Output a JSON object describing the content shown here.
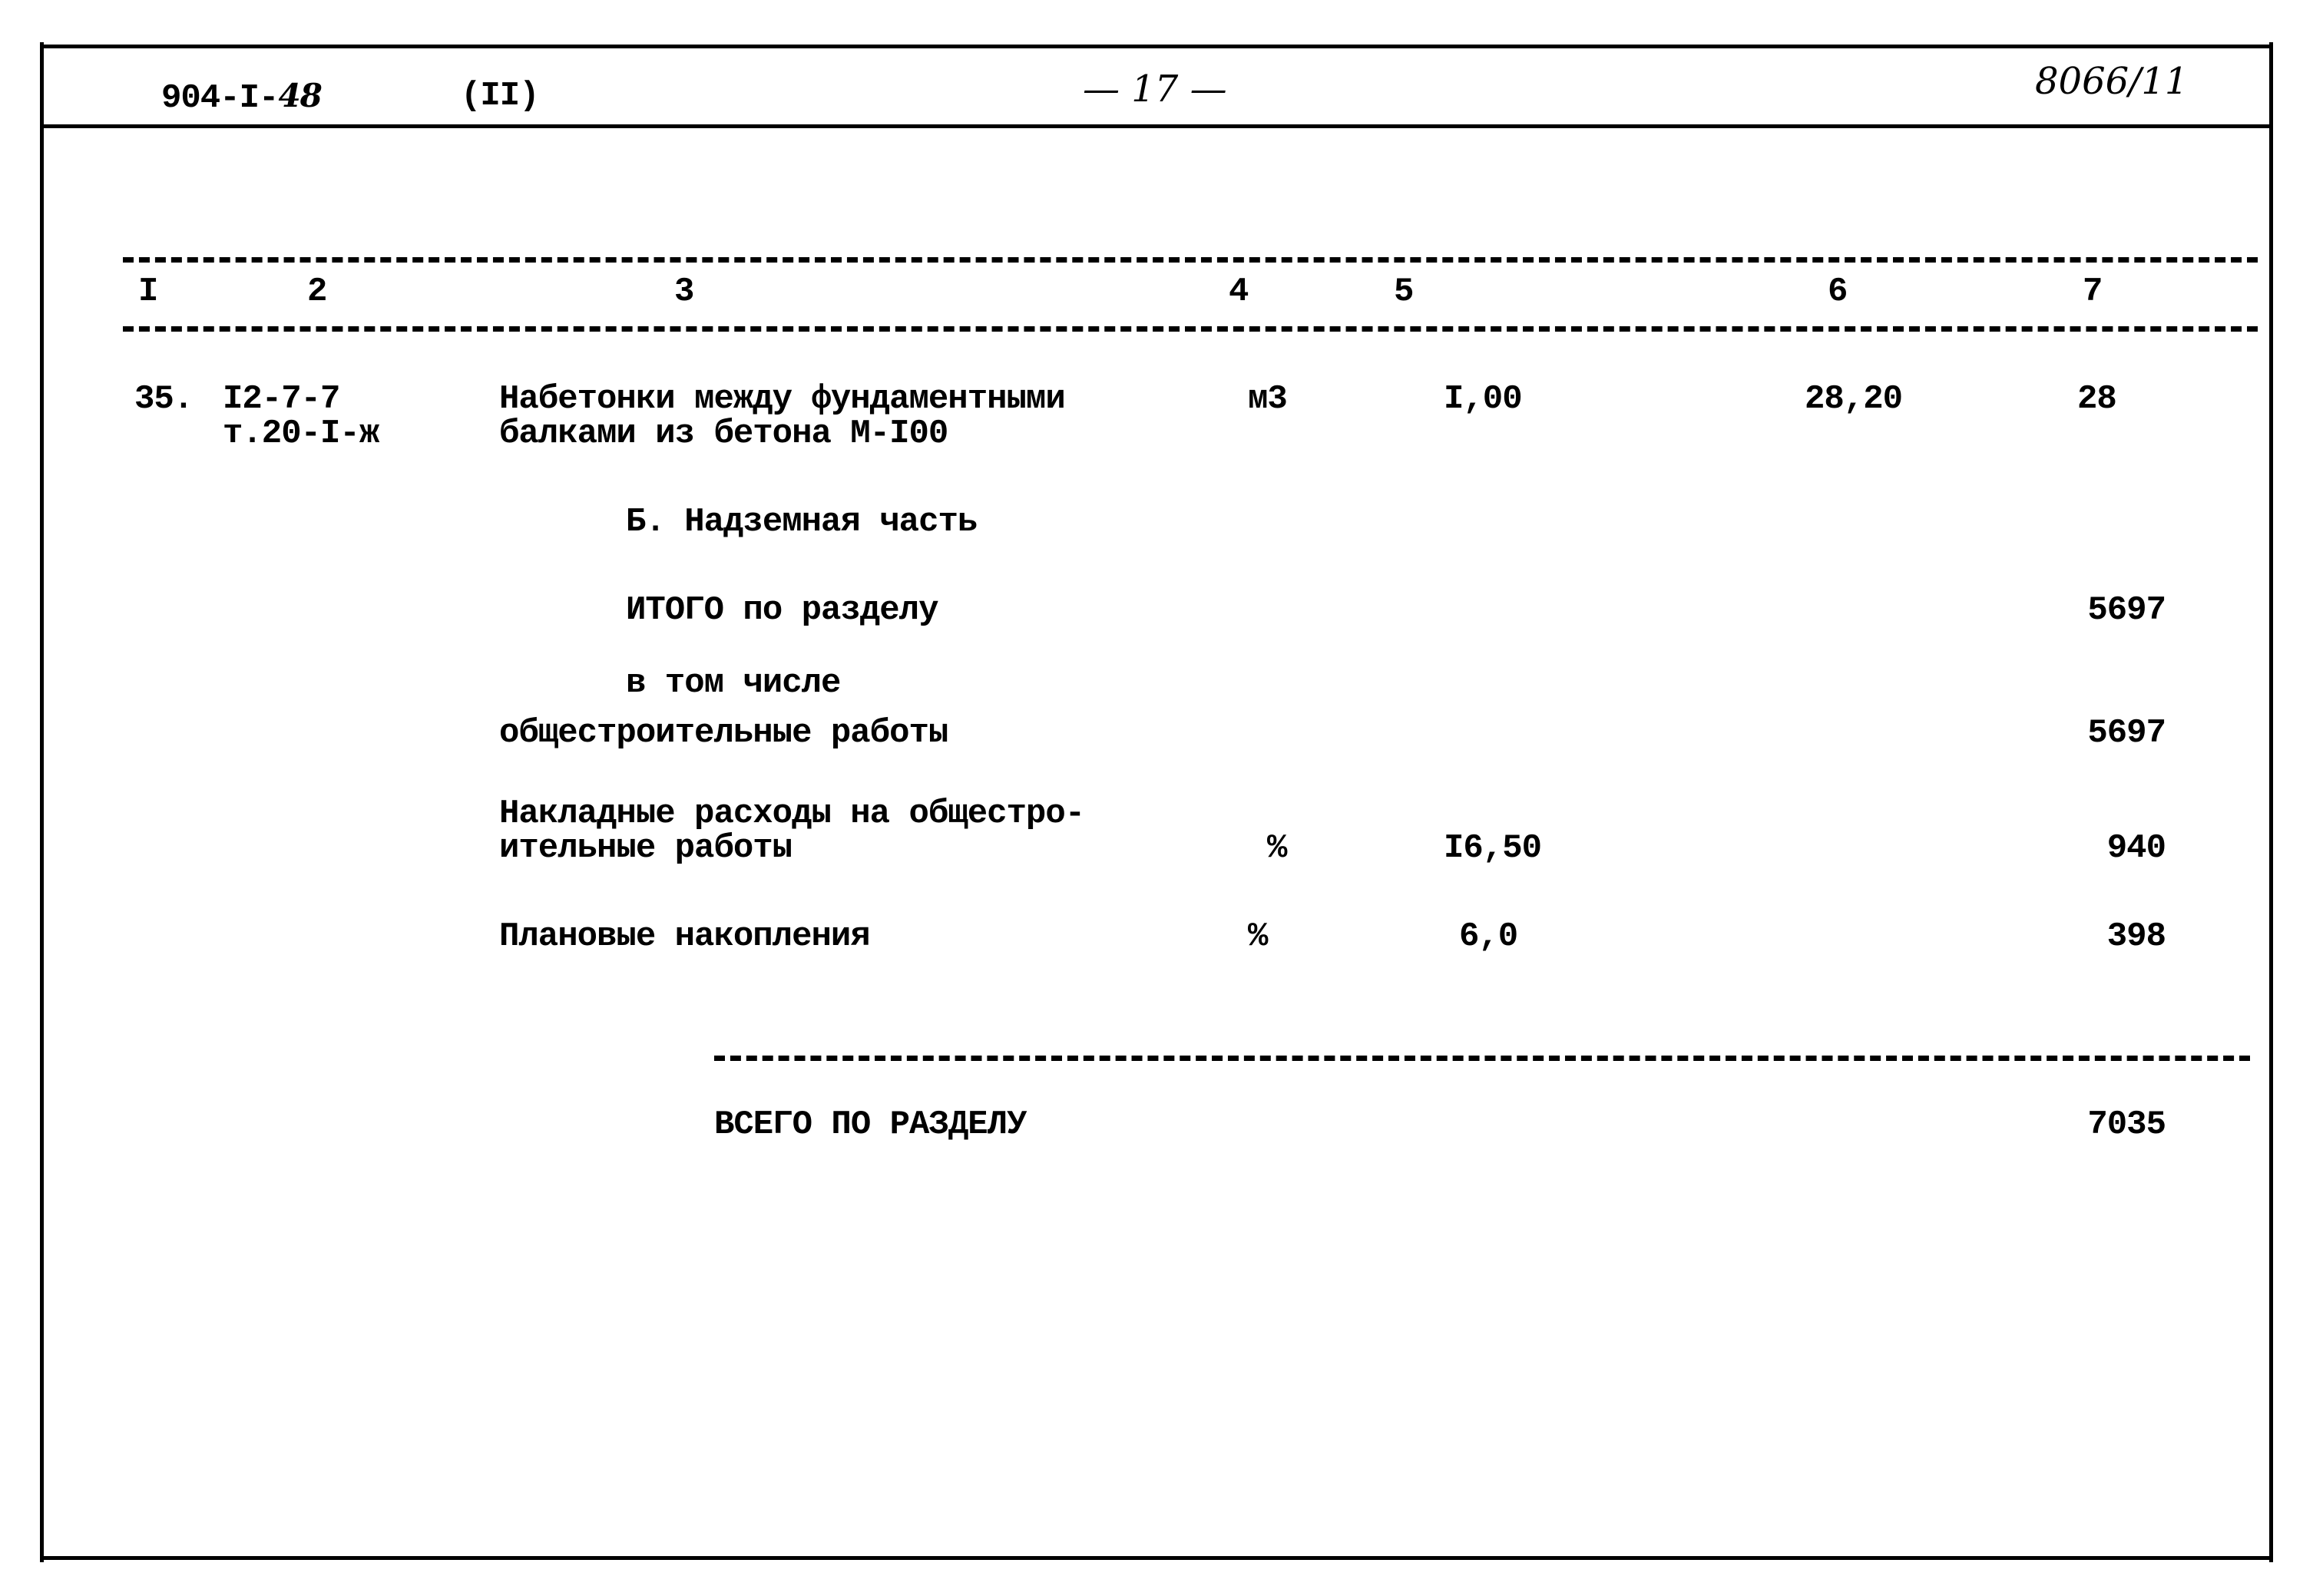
{
  "header": {
    "doc_code_printed": "904-I-",
    "doc_code_handwritten": "48",
    "part": "(II)",
    "page_number": "— 17 —",
    "sheet_ref": "8066/11"
  },
  "columns": [
    "I",
    "2",
    "3",
    "4",
    "5",
    "6",
    "7"
  ],
  "rows": [
    {
      "num": "35.",
      "code_line1": "I2-7-7",
      "code_line2": "т.20-I-ж",
      "desc_line1": "Набетонки между фундаментными",
      "desc_line2": "балками из бетона М-I00",
      "unit": "м3",
      "qty": "I,00",
      "price": "28,20",
      "total": "28"
    }
  ],
  "section": {
    "title": "Б. Надземная часть",
    "subtotal_label": "ИТОГО по разделу",
    "subtotal_value": "5697",
    "including_label": "в том числе",
    "general_works_label": "общестроительные работы",
    "general_works_value": "5697",
    "overhead_line1": "Накладные расходы на общестро-",
    "overhead_line2": "ительные работы",
    "overhead_unit": "%",
    "overhead_rate": "I6,50",
    "overhead_value": "940",
    "planned_label": "Плановые накопления",
    "planned_unit": "%",
    "planned_rate": "6,0",
    "planned_value": "398",
    "grand_total_label": "ВСЕГО ПО РАЗДЕЛУ",
    "grand_total_value": "7035"
  }
}
